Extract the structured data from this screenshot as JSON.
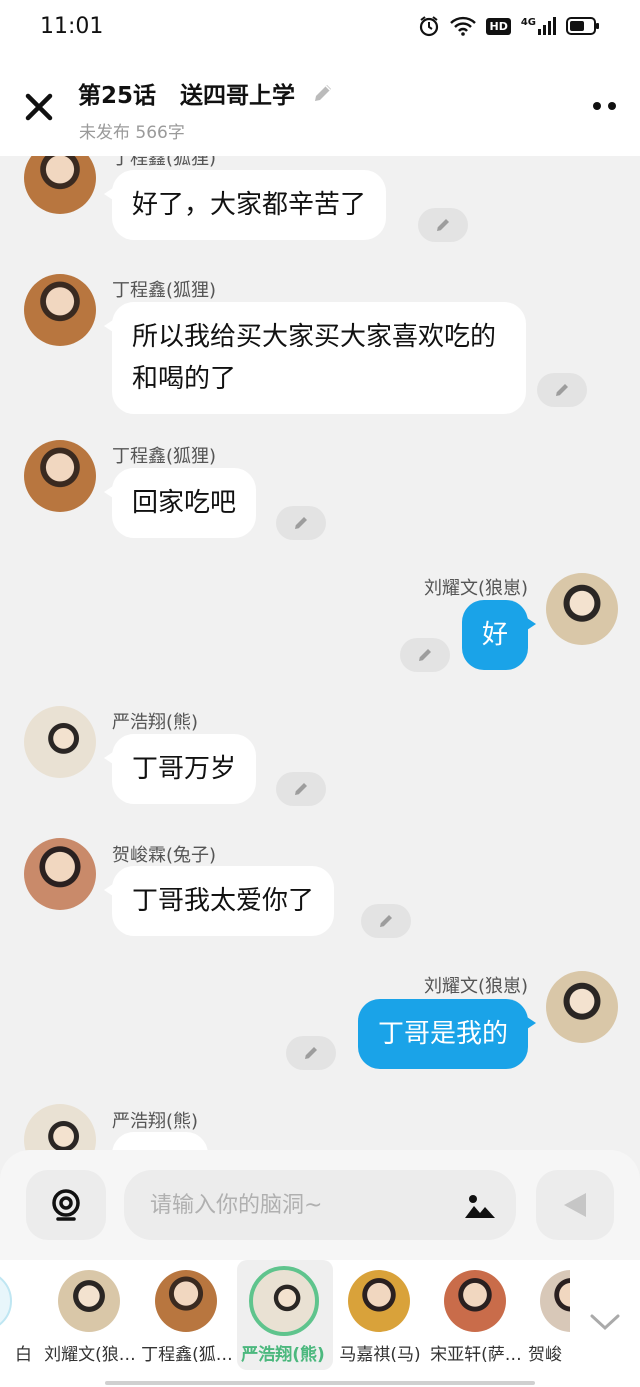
{
  "status_bar": {
    "time": "11:01",
    "network_hd": "HD",
    "network_gen": "4G"
  },
  "header": {
    "title": "第25话   送四哥上学",
    "subtitle": "未发布 566字"
  },
  "messages": [
    {
      "side": "left",
      "sender": "丁程鑫(狐狸)",
      "text": "好了，大家都辛苦了",
      "avatar_color": "#b8763f"
    },
    {
      "side": "left",
      "sender": "丁程鑫(狐狸)",
      "text": "所以我给买大家买大家喜欢吃的和喝的了",
      "avatar_color": "#b8763f"
    },
    {
      "side": "left",
      "sender": "丁程鑫(狐狸)",
      "text": "回家吃吧",
      "avatar_color": "#b8763f"
    },
    {
      "side": "right",
      "sender": "刘耀文(狼崽)",
      "text": "好",
      "avatar_color": "#d9c7a8"
    },
    {
      "side": "left",
      "sender": "严浩翔(熊)",
      "text": "丁哥万岁",
      "avatar_color": "#e9e1d3"
    },
    {
      "side": "left",
      "sender": "贺峻霖(兔子)",
      "text": "丁哥我太爱你了",
      "avatar_color": "#c98a6a"
    },
    {
      "side": "right",
      "sender": "刘耀文(狼崽)",
      "text": "丁哥是我的",
      "avatar_color": "#d9c7a8"
    },
    {
      "side": "left",
      "sender": "严浩翔(熊)",
      "text": "",
      "avatar_color": "#e9e1d3"
    }
  ],
  "input": {
    "placeholder": "请输入你的脑洞~"
  },
  "roles": [
    {
      "name": "白",
      "color": "#bfe6f2"
    },
    {
      "name": "刘耀文(狼…",
      "color": "#d9c7a8"
    },
    {
      "name": "丁程鑫(狐…",
      "color": "#b8763f"
    },
    {
      "name": "严浩翔(熊)",
      "color": "#e9e1d3",
      "active": true
    },
    {
      "name": "马嘉祺(马)",
      "color": "#d9a23a"
    },
    {
      "name": "宋亚轩(萨…",
      "color": "#c96c4a"
    },
    {
      "name": "贺峻",
      "color": "#d8c8b8"
    }
  ],
  "colors": {
    "bubble_right": "#1aa3e8",
    "active_role": "#4cb87e"
  },
  "icons": [
    "close-icon",
    "pencil-icon",
    "more-icon",
    "voice-icon",
    "image-icon",
    "send-icon",
    "chevron-down-icon"
  ]
}
